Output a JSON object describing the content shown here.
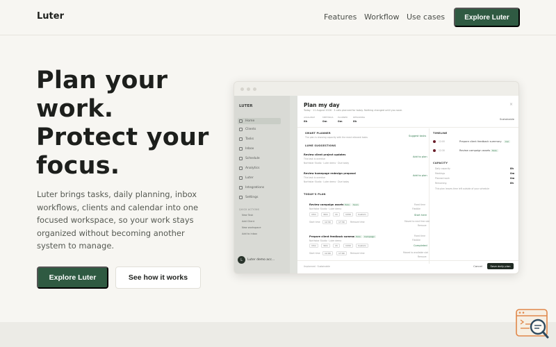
{
  "nav": {
    "brand": "Luter",
    "links": [
      "Features",
      "Workflow",
      "Use cases"
    ],
    "cta": "Explore Luter"
  },
  "hero": {
    "title_lines": [
      "Plan your",
      "work.",
      "Protect your",
      "focus."
    ],
    "body": "Luter brings tasks, daily planning, inbox workflows, clients and calendar into one focused workspace, so your work stays organized without becoming another system to manage.",
    "primary_cta": "Explore Luter",
    "secondary_cta": "See how it works"
  },
  "mockup": {
    "sidebar": {
      "logo": "LUTER",
      "items": [
        "Home",
        "Clients",
        "Tasks",
        "Inbox",
        "Schedule",
        "Analytics",
        "Luter",
        "Integrations",
        "Settings"
      ],
      "quick_head": "QUICK ACTIONS",
      "quick_items": [
        "New Task",
        "Add Client",
        "New workspace",
        "Add to inbox"
      ],
      "user": "Luter demo acc...",
      "avatar": "L"
    },
    "modal": {
      "title": "Plan my day",
      "subtitle": "Today · 11 August 2026 · 3 calls planned for today. Nothing changed until you save.",
      "stats": [
        {
          "label": "AVAILABLE",
          "value": "8h"
        },
        {
          "label": "MEETINGS",
          "value": "0m"
        },
        {
          "label": "PLANNED",
          "value": "0m"
        },
        {
          "label": "REMAINING",
          "value": "8h"
        }
      ],
      "sustain": "Sustainable",
      "smart_planner": "SMART PLANNER",
      "smart_desc": "The plan is showing capacity with the most relevant tasks",
      "suggest": "Suggest tasks",
      "lume": "LUME SUGGESTIONS",
      "sug1_title": "Review client project updates",
      "sug1_sub": "This task is overdue",
      "sug1_meta": "Northstar Studio · Luter demo · Due today",
      "sug1_add": "Add to plan",
      "sug2_title": "Review homepage redesign proposal",
      "sug2_sub": "This task is overdue",
      "sug2_meta": "Northstar Studio · Luter demo · Due today",
      "sug2_add": "Add to plan",
      "today": "TODAY'S PLAN",
      "plan1_title": "Review campaign assets",
      "plan1_tags": [
        "Todo",
        "Soon"
      ],
      "plan1_meta": "Northstar Studio · Luter demo",
      "plan1_durs": [
        "15m",
        "30m",
        "1h",
        "1h30",
        "Custom"
      ],
      "plan1_fixed": "Fixed time",
      "plan1_flex": "Flexible",
      "plan1_start": "Start time",
      "plan1_time": "12:30",
      "plan1_end": "17:30",
      "plan1_remove": "Remove time",
      "plan1_status": "Start here",
      "plan1_note": "Moved to next free slot",
      "plan1_remove_btn": "Remove",
      "plan2_title": "Prepare client feedback summary",
      "plan2_tags": [
        "Todo",
        "Campaign"
      ],
      "plan2_meta": "Northstar Studio · Luter demo",
      "plan2_durs": [
        "15m",
        "30m",
        "1h",
        "1h30",
        "Custom"
      ],
      "plan2_fixed": "Fixed time",
      "plan2_flex": "Flexible",
      "plan2_start": "Start time",
      "plan2_time": "12:00",
      "plan2_end": "17:00",
      "plan2_remove": "Remove time",
      "plan2_status": "Completed",
      "plan2_note": "Moved to available slot",
      "plan2_remove_btn": "Remove",
      "unplanned": "Unplanned · Sustainable",
      "timeline": "TIMELINE",
      "tl": [
        {
          "time": "12:00",
          "label": "Prepare client feedback summary",
          "tag": "Cal"
        },
        {
          "time": "12:30",
          "label": "Review campaign assets",
          "tag": "Todo"
        }
      ],
      "capacity": "CAPACITY",
      "cap_rows": [
        {
          "label": "Daily capacity",
          "value": "8h"
        },
        {
          "label": "Meetings",
          "value": "0m"
        },
        {
          "label": "Planned work",
          "value": "0m"
        },
        {
          "label": "Remaining",
          "value": "8h"
        }
      ],
      "cap_note": "This plan leaves time left outside of your schedule",
      "cancel": "Cancel",
      "save": "Save daily plan"
    }
  },
  "colors": {
    "accent": "#2f5a42",
    "background": "#f7f6f2",
    "text": "#1d1f1c"
  }
}
